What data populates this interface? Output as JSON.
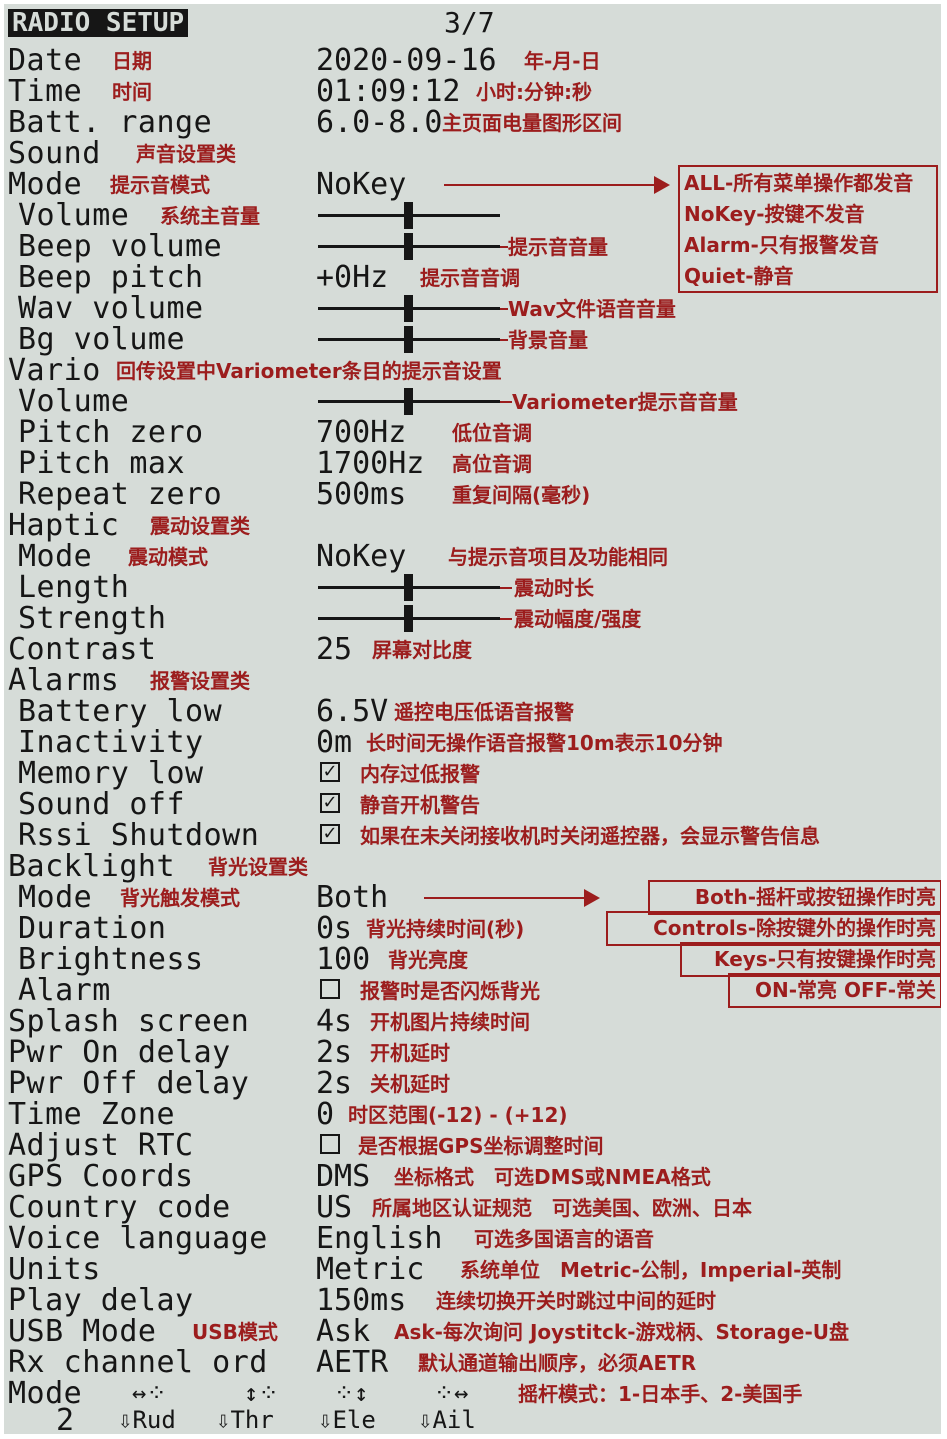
{
  "header": {
    "title": "RADIO SETUP",
    "page": "3/7"
  },
  "rows": {
    "date": {
      "label": "Date",
      "value": "2020-09-16",
      "note": "日期",
      "value_note": "年-月-日"
    },
    "time": {
      "label": "Time",
      "value": "01:09:12",
      "note": "时间",
      "value_note": "小时:分钟:秒"
    },
    "batt": {
      "label": "Batt. range",
      "value": "6.0-8.0",
      "value_note": "主页面电量图形区间"
    },
    "sound": {
      "label": "Sound",
      "note": "声音设置类"
    },
    "sound_mode": {
      "label": "Mode",
      "value": "NoKey",
      "note": "提示音模式"
    },
    "volume": {
      "label": "Volume",
      "note": "系统主音量",
      "level": 0.5
    },
    "beep_volume": {
      "label": "Beep volume",
      "note": "提示音音量",
      "level": 0.5
    },
    "beep_pitch": {
      "label": "Beep pitch",
      "value": "+0Hz",
      "value_note": "提示音音调"
    },
    "wav_volume": {
      "label": "Wav volume",
      "note": "Wav文件语音音量",
      "level": 0.5
    },
    "bg_volume": {
      "label": "Bg volume",
      "note": "背景音量",
      "level": 0.5
    },
    "vario": {
      "label": "Vario",
      "note": "回传设置中Variometer条目的提示音设置"
    },
    "vario_volume": {
      "label": "Volume",
      "note": "Variometer提示音音量",
      "level": 0.5
    },
    "pitch_zero": {
      "label": "Pitch zero",
      "value": "700Hz",
      "value_note": "低位音调"
    },
    "pitch_max": {
      "label": "Pitch max",
      "value": "1700Hz",
      "value_note": "高位音调"
    },
    "repeat_zero": {
      "label": "Repeat zero",
      "value": "500ms",
      "value_note": "重复间隔(毫秒)"
    },
    "haptic": {
      "label": "Haptic",
      "note": "震动设置类"
    },
    "haptic_mode": {
      "label": "Mode",
      "value": "NoKey",
      "note": "震动模式",
      "value_note": "与提示音项目及功能相同"
    },
    "length": {
      "label": "Length",
      "note": "震动时长",
      "level": 0.5
    },
    "strength": {
      "label": "Strength",
      "note": "震动幅度/强度",
      "level": 0.5
    },
    "contrast": {
      "label": "Contrast",
      "value": "25",
      "value_note": "屏幕对比度"
    },
    "alarms": {
      "label": "Alarms",
      "note": "报警设置类"
    },
    "battery_low": {
      "label": "Battery low",
      "value": "6.5V",
      "value_note": "遥控电压低语音报警"
    },
    "inactivity": {
      "label": "Inactivity",
      "value": "0m",
      "value_note": "长时间无操作语音报警10m表示10分钟"
    },
    "memory_low": {
      "label": "Memory low",
      "checked": true,
      "value_note": "内存过低报警"
    },
    "sound_off": {
      "label": "Sound off",
      "checked": true,
      "value_note": "静音开机警告"
    },
    "rssi_shutdown": {
      "label": "Rssi Shutdown",
      "checked": true,
      "value_note": "如果在未关闭接收机时关闭遥控器，会显示警告信息"
    },
    "backlight": {
      "label": "Backlight",
      "note": "背光设置类"
    },
    "backlight_mode": {
      "label": "Mode",
      "value": "Both",
      "note": "背光触发模式"
    },
    "duration": {
      "label": "Duration",
      "value": "0s",
      "value_note": "背光持续时间(秒)"
    },
    "brightness": {
      "label": "Brightness",
      "value": "100",
      "value_note": "背光亮度"
    },
    "alarm": {
      "label": "Alarm",
      "checked": false,
      "value_note": "报警时是否闪烁背光"
    },
    "splash": {
      "label": "Splash screen",
      "value": "4s",
      "value_note": "开机图片持续时间"
    },
    "pwr_on": {
      "label": "Pwr On delay",
      "value": "2s",
      "value_note": "开机延时"
    },
    "pwr_off": {
      "label": "Pwr Off delay",
      "value": "2s",
      "value_note": "关机延时"
    },
    "time_zone": {
      "label": "Time Zone",
      "value": "0",
      "value_note": "时区范围(-12) - (+12)"
    },
    "adjust_rtc": {
      "label": "Adjust RTC",
      "checked": false,
      "value_note": "是否根据GPS坐标调整时间"
    },
    "gps_coords": {
      "label": "GPS Coords",
      "value": "DMS",
      "value_note": "坐标格式　可选DMS或NMEA格式"
    },
    "country": {
      "label": "Country code",
      "value": "US",
      "value_note": "所属地区认证规范　可选美国、欧洲、日本"
    },
    "voice": {
      "label": "Voice language",
      "value": "English",
      "value_note": "可选多国语言的语音"
    },
    "units": {
      "label": "Units",
      "value": "Metric",
      "value_note": "系统单位　Metric-公制，Imperial-英制"
    },
    "play_delay": {
      "label": "Play delay",
      "value": "150ms",
      "value_note": "连续切换开关时跳过中间的延时"
    },
    "usb_mode": {
      "label": "USB Mode",
      "value": "Ask",
      "note": "USB模式",
      "value_note": "Ask-每次询问 Joystitck-游戏柄、Storage-U盘"
    },
    "rx_order": {
      "label": "Rx channel ord",
      "value": "AETR",
      "value_note": "默认通道输出顺序，必须AETR"
    },
    "stick_mode": {
      "label": "Mode",
      "value": "2",
      "value_note": "摇杆模式：1-日本手、2-美国手",
      "sticks": [
        "Rud",
        "Thr",
        "Ele",
        "Ail"
      ]
    }
  },
  "sound_mode_box": [
    "ALL-所有菜单操作都发音",
    "NoKey-按键不发音",
    "Alarm-只有报警发音",
    "Quiet-静音"
  ],
  "backlight_mode_box": [
    "Both-摇杆或按钮操作时亮",
    "Controls-除按键外的操作时亮",
    "Keys-只有按键操作时亮",
    "ON-常亮  OFF-常关"
  ],
  "colors": {
    "screen": "#d6dcd8",
    "text": "#161616",
    "annotation": "#9c1d1d"
  }
}
